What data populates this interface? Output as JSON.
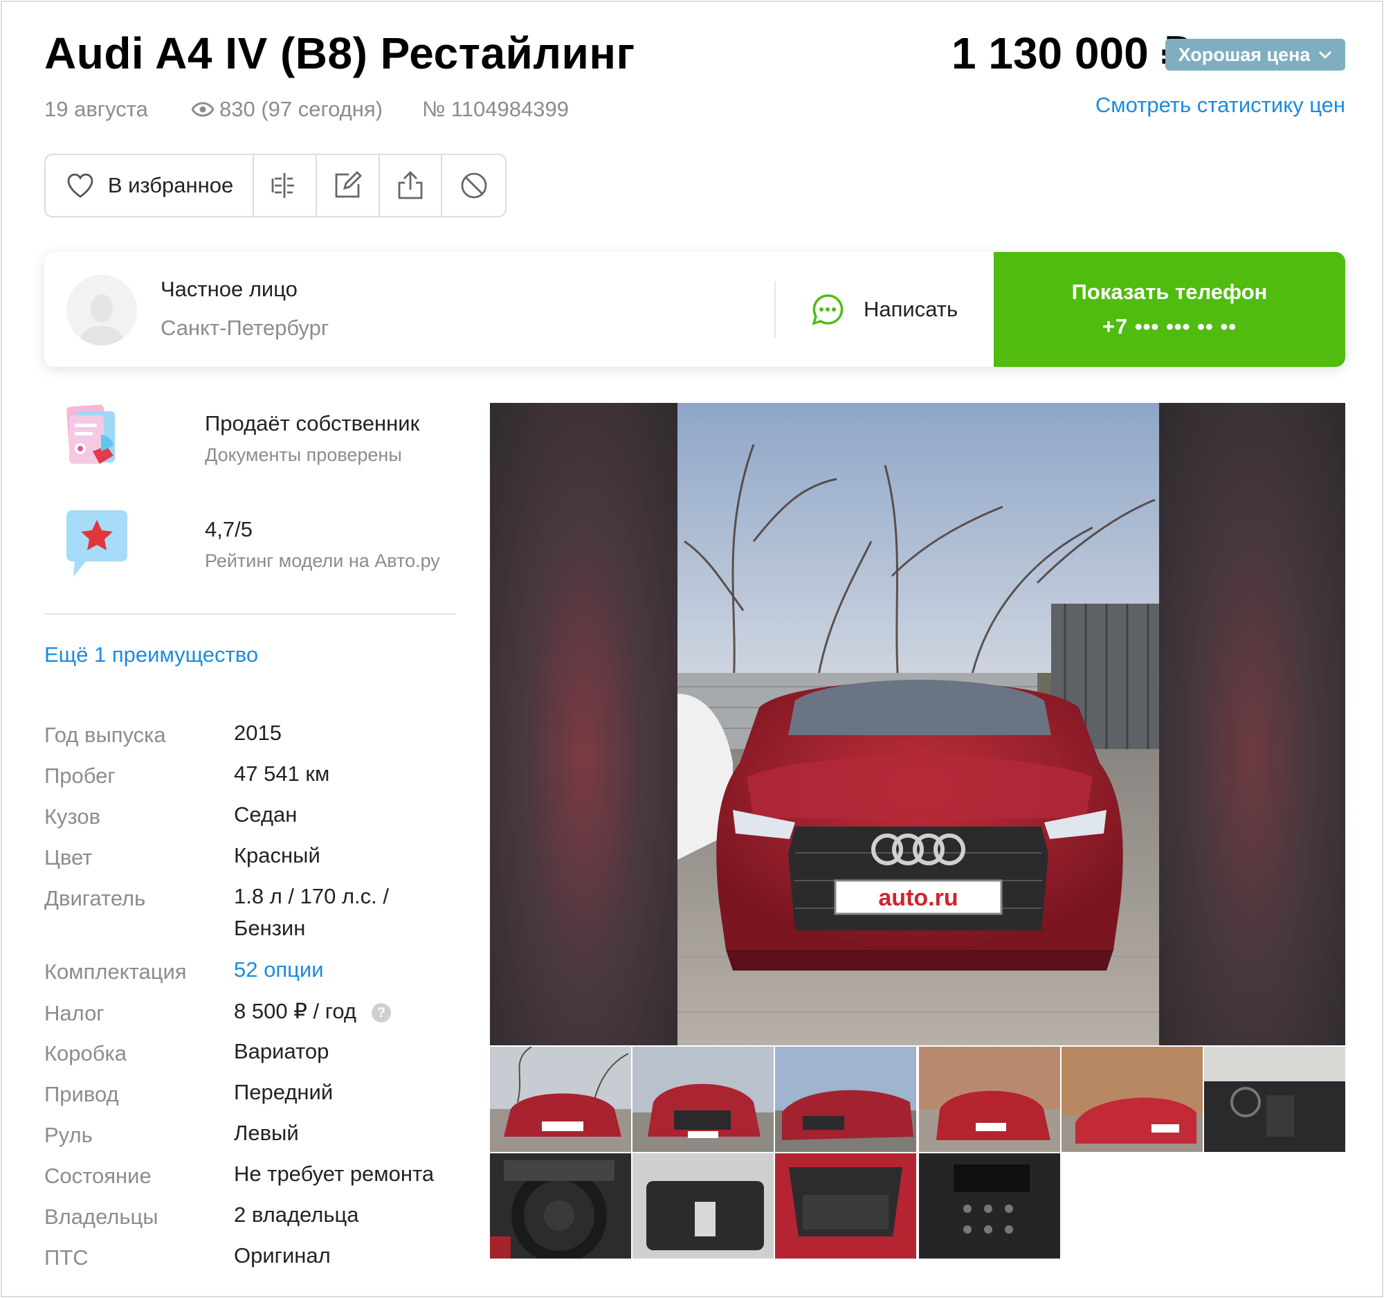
{
  "listing": {
    "title": "Audi A4 IV (B8) Рестайлинг",
    "date": "19 августа",
    "views": "830 (97 сегодня)",
    "number": "№ 1104984399",
    "price": "1 130 000 ₽",
    "price_badge": "Хорошая цена",
    "price_stats_link": "Смотреть статистику цен"
  },
  "actions": {
    "favorite_label": "В избранное",
    "icons": [
      "compare-icon",
      "edit-icon",
      "share-icon",
      "block-icon"
    ]
  },
  "seller": {
    "type": "Частное лицо",
    "city": "Санкт-Петербург",
    "write_label": "Написать",
    "phone_button_label": "Показать телефон",
    "phone_masked": "+7 ••• ••• •• ••"
  },
  "advantages": [
    {
      "title": "Продаёт собственник",
      "subtitle": "Документы проверены"
    },
    {
      "title": "4,7/5",
      "subtitle": "Рейтинг модели на Авто.ру"
    }
  ],
  "more_advantages_link": "Ещё 1 преимущество",
  "specs": [
    {
      "key": "Год выпуска",
      "value": "2015"
    },
    {
      "key": "Пробег",
      "value": "47 541 км"
    },
    {
      "key": "Кузов",
      "value": "Седан"
    },
    {
      "key": "Цвет",
      "value": "Красный"
    },
    {
      "key": "Двигатель",
      "value": "1.8 л / 170 л.с. / Бензин"
    },
    {
      "key": "Комплектация",
      "value": "52 опции"
    },
    {
      "key": "Налог",
      "value": "8 500 ₽ / год"
    },
    {
      "key": "Коробка",
      "value": "Вариатор"
    },
    {
      "key": "Привод",
      "value": "Передний"
    },
    {
      "key": "Руль",
      "value": "Левый"
    },
    {
      "key": "Состояние",
      "value": "Не требует ремонта"
    },
    {
      "key": "Владельцы",
      "value": "2 владельца"
    },
    {
      "key": "ПТС",
      "value": "Оригинал"
    }
  ],
  "help_glyph": "?",
  "photo": {
    "plate_text": "auto.ru"
  },
  "colors": {
    "accent_green": "#4fbc0f",
    "link_blue": "#1a8be0",
    "badge": "#7faec0",
    "car_red": "#a61e2a"
  }
}
